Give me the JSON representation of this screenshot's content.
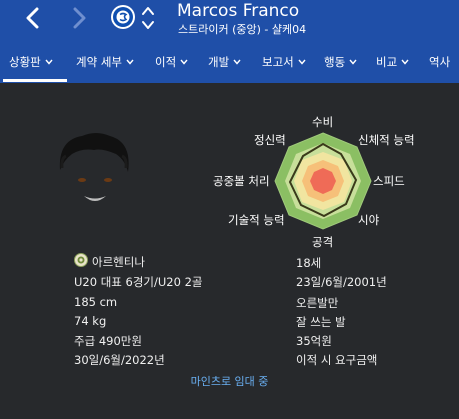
{
  "header": {
    "player_name": "Marcos Franco",
    "player_subtitle": "스트라이커 (중앙) - 샬케04",
    "icons": [
      "back-arrow-icon",
      "forward-arrow-icon",
      "club-badge-icon",
      "club-switch-icon"
    ],
    "colors": {
      "header_bg": "#1f4fa8",
      "body_bg": "#27292c",
      "link": "#6ab0f3"
    }
  },
  "tabs": [
    {
      "label": "상황판",
      "selected": true
    },
    {
      "label": "계약 세부"
    },
    {
      "label": "이적"
    },
    {
      "label": "개발"
    },
    {
      "label": "보고서"
    },
    {
      "label": "행동"
    },
    {
      "label": "비교"
    },
    {
      "label": "역사"
    }
  ],
  "radar": {
    "labels": {
      "defense": "수비",
      "physical": "신체적 능력",
      "speed": "스피드",
      "vision": "시야",
      "attack": "공격",
      "technical": "기술적 능력",
      "aerial": "공중볼 처리",
      "mental": "정신력"
    }
  },
  "info": {
    "nationality": "아르헨티나",
    "international": "U20 대표 6경기/U20 2골",
    "height": "185 cm",
    "weight": "74 kg",
    "wage": "주급 490만원",
    "contract_end": "30일/6월/2022년",
    "age": "18세",
    "birth_date": "23일/6월/2001년",
    "preferred_foot": "오른발만",
    "weak_foot": "잘 쓰는 발",
    "value": "35억원",
    "transfer_note": "이적 시 요구금액"
  },
  "loan_link": "마인츠로 임대 중"
}
